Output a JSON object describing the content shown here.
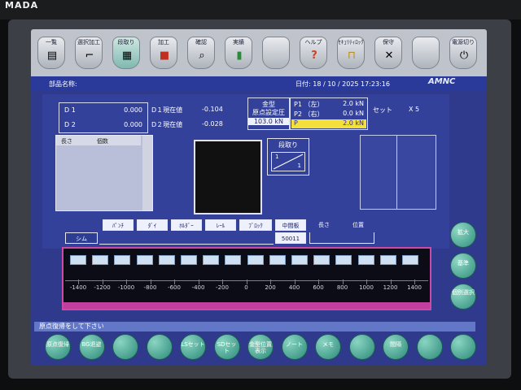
{
  "brand": "MADA",
  "toolbar": [
    {
      "label": "一覧",
      "icon": "list-icon"
    },
    {
      "label": "選択加工",
      "icon": "bend-icon"
    },
    {
      "label": "段取り",
      "icon": "setup-icon",
      "active": true
    },
    {
      "label": "加工",
      "icon": "press-icon"
    },
    {
      "label": "確認",
      "icon": "magnifier-icon"
    },
    {
      "label": "実績",
      "icon": "chart-icon"
    },
    {
      "label": "",
      "icon": ""
    },
    {
      "label": "ヘルプ",
      "icon": "help-icon"
    },
    {
      "label": "ｾｷｭﾘﾃｨﾛｯｸ",
      "icon": "lock-icon"
    },
    {
      "label": "保守",
      "icon": "tools-icon"
    },
    {
      "label": "",
      "icon": ""
    },
    {
      "label": "電源切り",
      "icon": "power-icon"
    }
  ],
  "header": {
    "part_name_label": "部品名称:",
    "date_text": "日付:  18 / 10 / 2025  17:23:16",
    "logo": "AMNC"
  },
  "d_values": {
    "d1_label": "D 1",
    "d1_value": "0.000",
    "d2_label": "D 2",
    "d2_value": "0.000",
    "d1_current_label": "D１現在値",
    "d1_current_value": "-0.104",
    "d2_current_label": "D２現在値",
    "d2_current_value": "-0.028"
  },
  "mold": {
    "label": "金型",
    "label2": "原点設定圧",
    "value": "103.0 kN"
  },
  "pressure": {
    "p1_label": "P1 （左）",
    "p1_value": "2.0 kN",
    "p2_label": "P2 （右）",
    "p2_value": "0.0 kN",
    "p_label": "P",
    "p_value": "2.0 kN",
    "set_label": "セット",
    "multiplier": "X 5"
  },
  "list": {
    "col1": "長さ",
    "col2": "個数"
  },
  "setup_box": {
    "title": "段取り",
    "line1": "1",
    "line2": "1"
  },
  "tabs": {
    "shim": "シム",
    "punch": "ﾊﾟﾝﾁ",
    "die": "ﾀﾞｲ",
    "holder": "ﾎﾙﾀﾞｰ",
    "rail": "ﾚｰﾙ",
    "block": "ﾌﾞﾛｯｸ",
    "middle_plate": "中間板",
    "middle_plate_value": "50011",
    "length": "長さ",
    "position": "位置"
  },
  "ruler": {
    "ticks": [
      "-1400",
      "-1200",
      "-1000",
      "-800",
      "-600",
      "-400",
      "-200",
      "0",
      "200",
      "400",
      "600",
      "800",
      "1000",
      "1200",
      "1400"
    ]
  },
  "side_buttons": [
    {
      "label": "拡大"
    },
    {
      "label": "基準"
    },
    {
      "label": "個別選択"
    }
  ],
  "message": "原点復帰をして下さい",
  "bottom_buttons": [
    {
      "label": "原点復帰"
    },
    {
      "label": "BG退避"
    },
    {
      "label": ""
    },
    {
      "label": ""
    },
    {
      "label": "LSセット"
    },
    {
      "label": "SDセット"
    },
    {
      "label": "金型位置表示"
    },
    {
      "label": "ノート"
    },
    {
      "label": "メモ"
    },
    {
      "label": ""
    },
    {
      "label": "間隔"
    },
    {
      "label": ""
    },
    {
      "label": ""
    }
  ]
}
